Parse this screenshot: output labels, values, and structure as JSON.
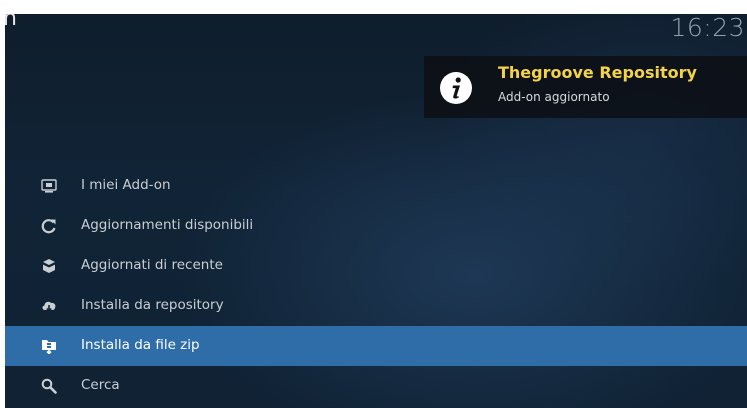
{
  "header": {
    "heading_fragment": "n",
    "clock": "16:23"
  },
  "notification": {
    "icon": "info-icon",
    "title": "Thegroove Repository",
    "message": "Add-on aggiornato",
    "title_color": "#f4d348"
  },
  "menu": {
    "items": [
      {
        "label": "I miei Add-on",
        "icon": "monitor-addon-icon",
        "selected": false
      },
      {
        "label": "Aggiornamenti disponibili",
        "icon": "refresh-icon",
        "selected": false
      },
      {
        "label": "Aggiornati di recente",
        "icon": "open-box-icon",
        "selected": false
      },
      {
        "label": "Installa da repository",
        "icon": "cloud-download-icon",
        "selected": false
      },
      {
        "label": "Installa da file zip",
        "icon": "zip-file-icon",
        "selected": true
      },
      {
        "label": "Cerca",
        "icon": "search-icon",
        "selected": false
      }
    ],
    "selected_color": "#2e6da8"
  }
}
